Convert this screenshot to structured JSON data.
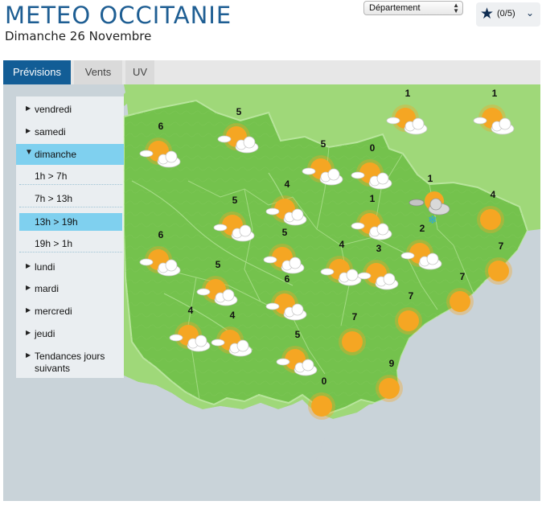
{
  "header": {
    "title": "METEO OCCITANIE",
    "date": "Dimanche 26 Novembre",
    "department_select": "Département",
    "favorites_count": "(0/5)"
  },
  "tabs": [
    {
      "label": "Prévisions",
      "active": true
    },
    {
      "label": "Vents",
      "active": false
    },
    {
      "label": "UV",
      "active": false
    }
  ],
  "sidebar": {
    "days": [
      "vendredi",
      "samedi",
      "dimanche",
      "lundi",
      "mardi",
      "mercredi",
      "jeudi"
    ],
    "open_day": "dimanche",
    "time_slots": [
      "1h > 7h",
      "7h > 13h",
      "13h > 19h",
      "19h > 1h"
    ],
    "active_slot": "13h > 19h",
    "trends": "Tendances jours suivants"
  },
  "colors": {
    "title_blue": "#1e5e93",
    "tab_active": "#125d96",
    "sidebar_highlight": "#7fd0ef",
    "land_green": "#8ed167",
    "region_green": "#74c24d",
    "sea": "#c9d3d9",
    "sun": "#f5a623"
  },
  "map": {
    "icons": [
      {
        "value": "6",
        "icon": "sun-cloud-icon"
      },
      {
        "value": "5",
        "icon": "sun-cloud-icon"
      },
      {
        "value": "1",
        "icon": "sun-cloud-icon"
      },
      {
        "value": "1",
        "icon": "sun-cloud-icon"
      },
      {
        "value": "5",
        "icon": "sun-cloud-icon"
      },
      {
        "value": "0",
        "icon": "sun-cloud-icon"
      },
      {
        "value": "4",
        "icon": "sun-cloud-icon"
      },
      {
        "value": "1",
        "icon": "snow-cloud-icon"
      },
      {
        "value": "5",
        "icon": "sun-cloud-icon"
      },
      {
        "value": "1",
        "icon": "sun-cloud-icon"
      },
      {
        "value": "4",
        "icon": "sun-icon"
      },
      {
        "value": "6",
        "icon": "sun-cloud-icon"
      },
      {
        "value": "5",
        "icon": "sun-cloud-icon"
      },
      {
        "value": "4",
        "icon": "sun-cloud-icon"
      },
      {
        "value": "3",
        "icon": "sun-cloud-icon"
      },
      {
        "value": "2",
        "icon": "sun-cloud-icon"
      },
      {
        "value": "7",
        "icon": "sun-icon"
      },
      {
        "value": "5",
        "icon": "sun-cloud-icon"
      },
      {
        "value": "6",
        "icon": "sun-cloud-icon"
      },
      {
        "value": "7",
        "icon": "sun-icon"
      },
      {
        "value": "4",
        "icon": "sun-cloud-icon"
      },
      {
        "value": "4",
        "icon": "sun-cloud-icon"
      },
      {
        "value": "7",
        "icon": "sun-icon"
      },
      {
        "value": "7",
        "icon": "sun-icon"
      },
      {
        "value": "5",
        "icon": "sun-cloud-icon"
      },
      {
        "value": "9",
        "icon": "sun-icon"
      },
      {
        "value": "0",
        "icon": "sun-icon"
      }
    ]
  }
}
